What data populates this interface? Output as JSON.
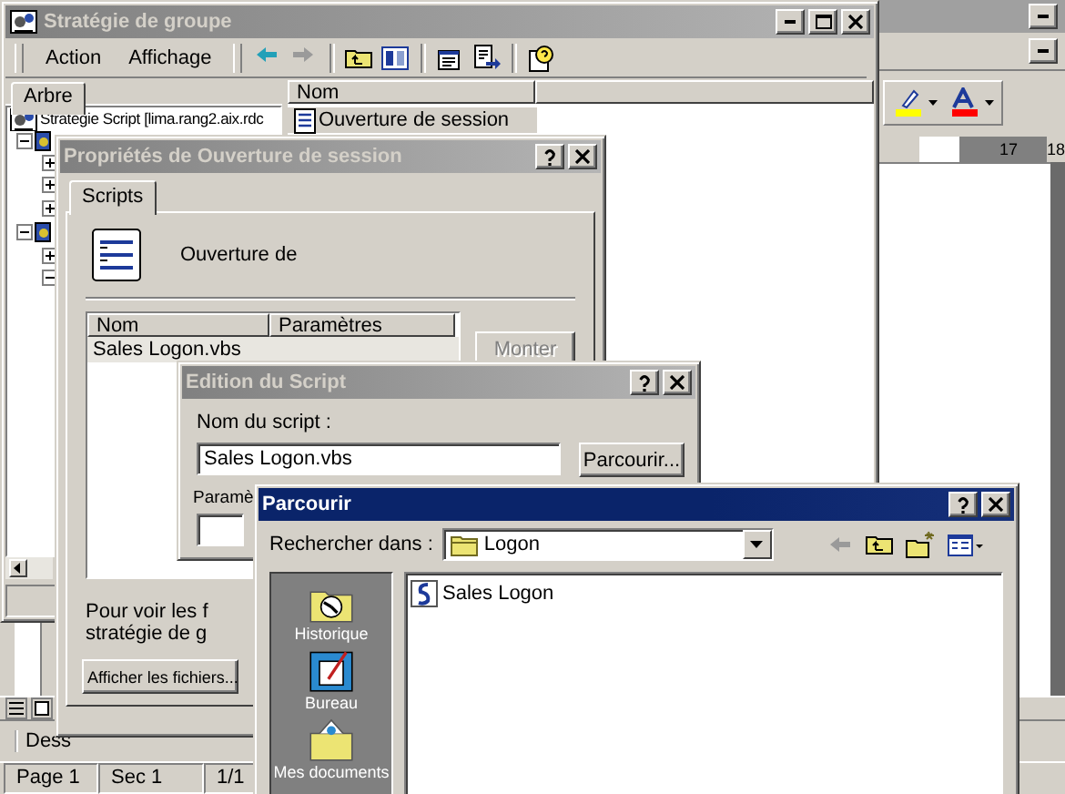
{
  "word_window": {
    "active": false,
    "ruler_labels": [
      "17",
      "18"
    ],
    "drawing_toolbar_label": "Dess",
    "status_bar": [
      "Page 1",
      "Sec 1",
      "1/1"
    ]
  },
  "mmc_window": {
    "title": "Stratégie de groupe",
    "active": false,
    "menu": [
      "Action",
      "Affichage"
    ],
    "tree_tab": {
      "label": "Arbre",
      "selected": true
    },
    "tree": [
      {
        "label": "Stratégie Script [lima.rang2.aix.rdc",
        "children": [
          {
            "expanded": true,
            "children": [
              {
                "expanded": false
              },
              {
                "expanded": false
              },
              {
                "expanded": false
              }
            ]
          },
          {
            "expanded": true,
            "children": [
              {
                "expanded": false
              },
              {
                "expanded": true
              }
            ]
          }
        ]
      }
    ],
    "list_columns": [
      "Nom"
    ],
    "list_items": [
      {
        "label": "Ouverture de session",
        "selected": true
      }
    ]
  },
  "properties_dialog": {
    "title": "Propriétés de Ouverture de session",
    "active": false,
    "tabs": [
      {
        "label": "Scripts",
        "selected": true
      }
    ],
    "heading": "Ouverture de",
    "columns": [
      "Nom",
      "Paramètres"
    ],
    "rows": [
      {
        "name": "Sales Logon.vbs",
        "selected": true
      }
    ],
    "move_button": {
      "label": "Monter",
      "disabled": true
    },
    "note": [
      "Pour voir les f",
      "stratégie de g"
    ],
    "show_files_button": {
      "label": "Afficher les fichiers...",
      "disabled": false
    }
  },
  "edit_dialog": {
    "title": "Edition du Script",
    "active": false,
    "script_label": "Nom du script :",
    "script_value": "Sales Logon.vbs",
    "browse_button": "Parcourir...",
    "params_label": "Paramè"
  },
  "browse_dialog": {
    "title": "Parcourir",
    "active": true,
    "look_in_label": "Rechercher dans :",
    "look_in_value": "Logon",
    "places": [
      {
        "label": "Historique",
        "kind": "history"
      },
      {
        "label": "Bureau",
        "kind": "desktop"
      },
      {
        "label": "Mes documents",
        "kind": "documents"
      }
    ],
    "files": [
      {
        "label": "Sales Logon"
      }
    ]
  }
}
